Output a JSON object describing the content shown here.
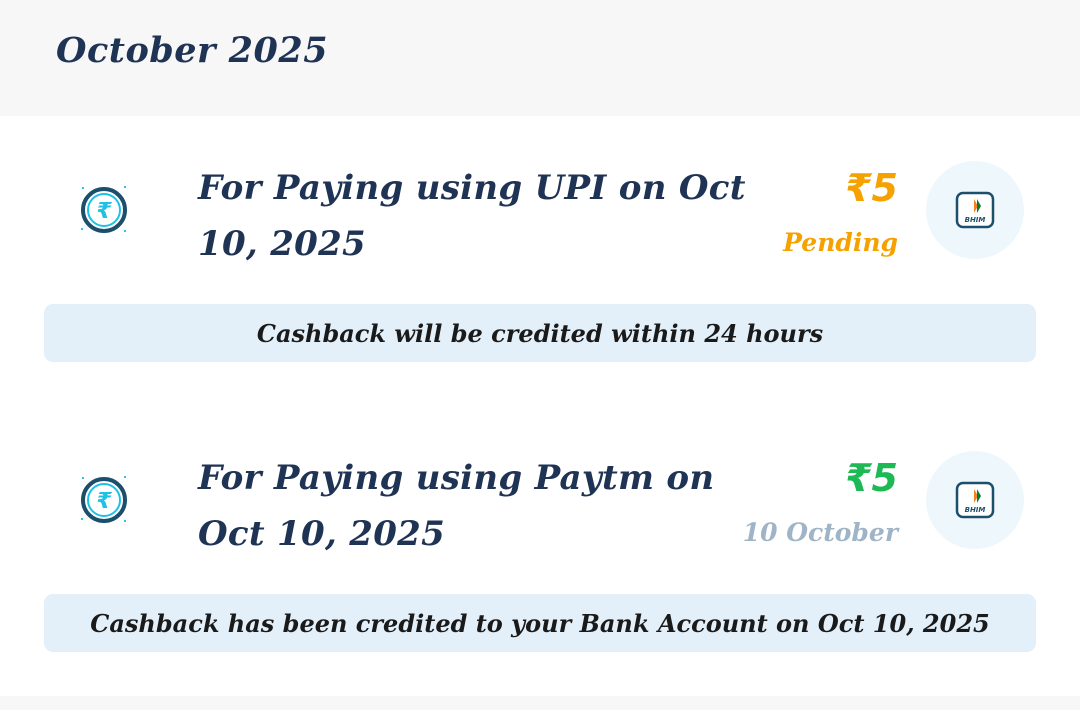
{
  "month_title": "October 2025",
  "transactions": [
    {
      "title": "For Paying using UPI on Oct 10, 2025",
      "amount": "₹5",
      "amount_color": "#f5a100",
      "status": "Pending",
      "status_color": "#f5a100",
      "app_icon": "bhim-icon",
      "app_label": "BHIM",
      "note": "Cashback will be credited within 24 hours"
    },
    {
      "title": "For Paying using Paytm on Oct 10, 2025",
      "amount": "₹5",
      "amount_color": "#1db954",
      "status": "10 October",
      "status_color": "#9fb4c6",
      "app_icon": "bhim-icon",
      "app_label": "BHIM",
      "note": "Cashback has been credited to your Bank Account on Oct 10, 2025"
    }
  ],
  "colors": {
    "header_bg": "#f7f7f7",
    "note_bg": "#e3f0f9",
    "title_text": "#1f3354",
    "icon_accent": "#1fc1e6",
    "icon_ring": "#1b4f6b"
  }
}
